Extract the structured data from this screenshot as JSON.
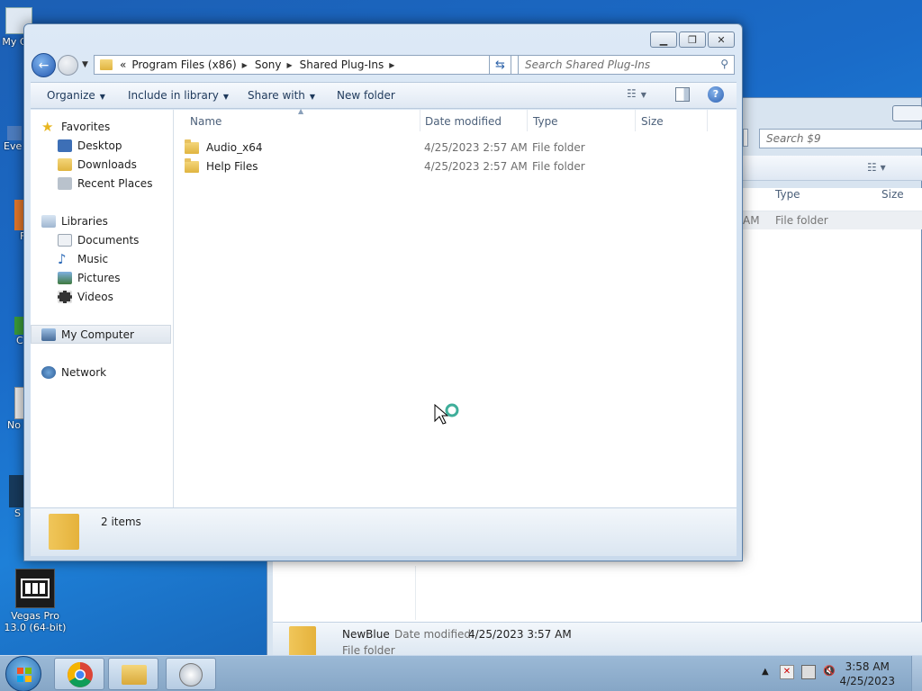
{
  "desktop": {
    "icons": [
      {
        "label": "My C"
      },
      {
        "label": "Eve"
      },
      {
        "label": "F"
      },
      {
        "label": "C"
      },
      {
        "label": "No"
      },
      {
        "label": "S"
      },
      {
        "label": "Vegas Pro 13.0 (64-bit)"
      }
    ]
  },
  "background_window": {
    "search_placeholder": "Search $9",
    "columns": [
      "Type",
      "Size"
    ],
    "row_type": "File folder",
    "row_date_fragment": "AM",
    "preview": {
      "name": "NewBlue",
      "date_label": "Date modified:",
      "date_value": "4/25/2023 3:57 AM",
      "type": "File folder"
    }
  },
  "window": {
    "breadcrumb": [
      "Program Files (x86)",
      "Sony",
      "Shared Plug-Ins"
    ],
    "breadcrumb_prefix": "«",
    "search_placeholder": "Search Shared Plug-Ins",
    "toolbar": {
      "organize": "Organize",
      "include": "Include in library",
      "share": "Share with",
      "new_folder": "New folder"
    },
    "nav": {
      "favorites": "Favorites",
      "desktop": "Desktop",
      "downloads": "Downloads",
      "recent": "Recent Places",
      "libraries": "Libraries",
      "documents": "Documents",
      "music": "Music",
      "pictures": "Pictures",
      "videos": "Videos",
      "computer": "My Computer",
      "network": "Network"
    },
    "columns": {
      "name": "Name",
      "date": "Date modified",
      "type": "Type",
      "size": "Size"
    },
    "files": [
      {
        "name": "Audio_x64",
        "date": "4/25/2023 2:57 AM",
        "type": "File folder"
      },
      {
        "name": "Help Files",
        "date": "4/25/2023 2:57 AM",
        "type": "File folder"
      }
    ],
    "status": "2 items"
  },
  "taskbar": {
    "time": "3:58 AM",
    "date": "4/25/2023"
  }
}
